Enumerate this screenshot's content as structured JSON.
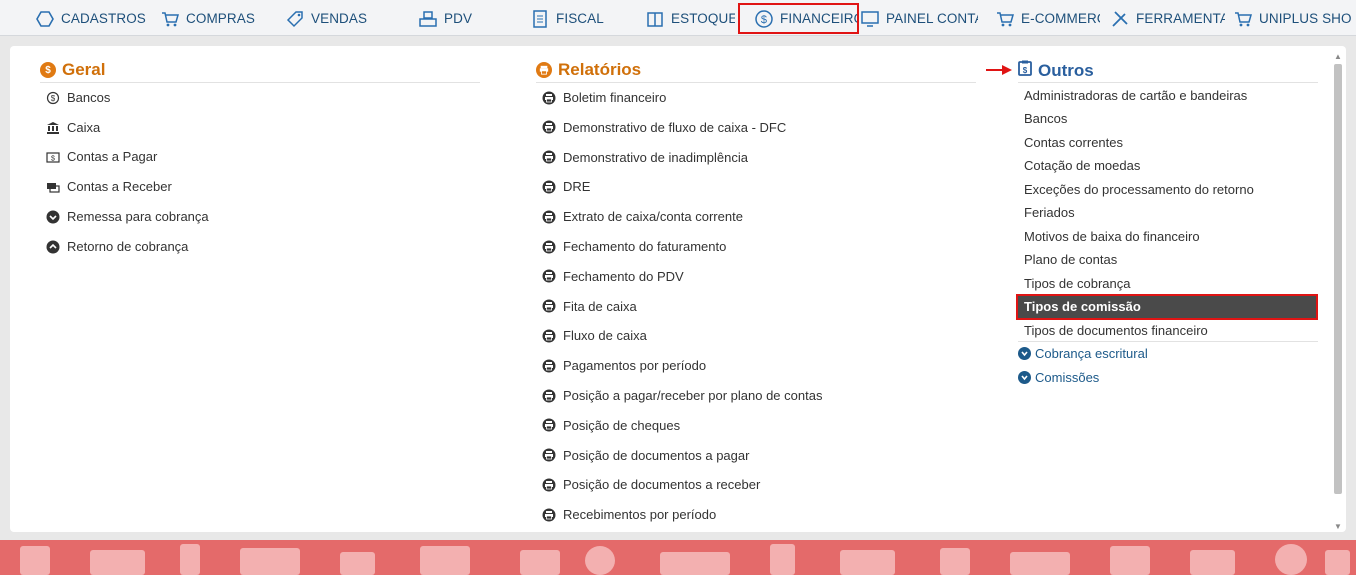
{
  "nav": {
    "items": [
      {
        "label": "CADASTROS",
        "icon": "hexagon-icon"
      },
      {
        "label": "COMPRAS",
        "icon": "cart-icon"
      },
      {
        "label": "VENDAS",
        "icon": "tag-icon"
      },
      {
        "label": "PDV",
        "icon": "register-icon"
      },
      {
        "label": "FISCAL",
        "icon": "document-icon"
      },
      {
        "label": "ESTOQUE",
        "icon": "box-icon"
      },
      {
        "label": "FINANCEIRO",
        "icon": "dollar-circle-icon"
      },
      {
        "label": "PAINEL CONTADOR",
        "icon": "monitor-icon"
      },
      {
        "label": "E-COMMERCE",
        "icon": "cart-icon"
      },
      {
        "label": "FERRAMENTAS",
        "icon": "tools-icon"
      },
      {
        "label": "UNIPLUS SHOP",
        "icon": "cart-icon"
      }
    ],
    "active": "FINANCEIRO"
  },
  "geral": {
    "title": "Geral",
    "title_icon": "dollar-circle-icon",
    "items": [
      {
        "label": "Bancos",
        "icon": "dollar-circle-icon"
      },
      {
        "label": "Caixa",
        "icon": "bank-icon"
      },
      {
        "label": "Contas a Pagar",
        "icon": "bill-icon"
      },
      {
        "label": "Contas a Receber",
        "icon": "money-icon"
      },
      {
        "label": "Remessa para cobrança",
        "icon": "chevron-down-circle-icon"
      },
      {
        "label": "Retorno de cobrança",
        "icon": "chevron-up-circle-icon"
      }
    ]
  },
  "relatorios": {
    "title": "Relatórios",
    "title_icon": "printer-icon",
    "items": [
      "Boletim financeiro",
      "Demonstrativo de fluxo de caixa - DFC",
      "Demonstrativo de inadimplência",
      "DRE",
      "Extrato de caixa/conta corrente",
      "Fechamento do faturamento",
      "Fechamento do PDV",
      "Fita de caixa",
      "Fluxo de caixa",
      "Pagamentos por período",
      "Posição a pagar/receber por plano de contas",
      "Posição de cheques",
      "Posição de documentos a pagar",
      "Posição de documentos a receber",
      "Recebimentos por período"
    ]
  },
  "outros": {
    "title": "Outros",
    "title_icon": "clipboard-dollar-icon",
    "items": [
      "Administradoras de cartão e bandeiras",
      "Bancos",
      "Contas correntes",
      "Cotação de moedas",
      "Exceções do processamento do retorno",
      "Feriados",
      "Motivos de baixa do financeiro",
      "Plano de contas",
      "Tipos de cobrança",
      "Tipos de comissão",
      "Tipos de documentos financeiro"
    ],
    "selected": "Tipos de comissão",
    "groups": [
      "Cobrança escritural",
      "Comissões"
    ]
  },
  "colors": {
    "nav_text": "#1d4f7a",
    "accent_orange": "#d0700a",
    "accent_blue": "#2a5f9e",
    "highlight_border": "#e01414",
    "selected_bg": "#4a4a4a",
    "footer": "#e46a6a"
  }
}
